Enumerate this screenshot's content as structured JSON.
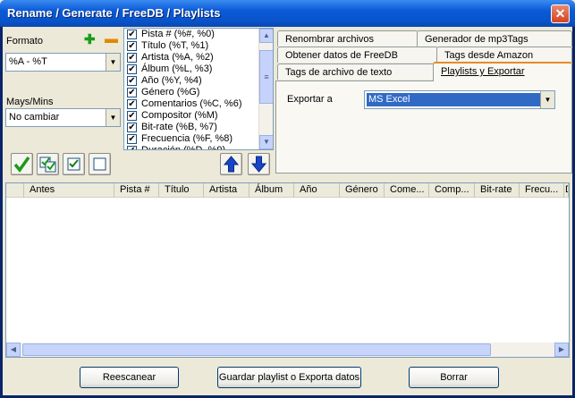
{
  "window": {
    "title": "Rename / Generate / FreeDB / Playlists",
    "close_label": "✕"
  },
  "formato": {
    "label": "Formato",
    "add_icon": "plus-icon",
    "remove_icon": "minus-icon",
    "value": "%A - %T"
  },
  "mays": {
    "label": "Mays/Mins",
    "value": "No cambiar"
  },
  "fields": [
    {
      "label": "Pista # (%#, %0)",
      "checked": true
    },
    {
      "label": "Título (%T, %1)",
      "checked": true
    },
    {
      "label": "Artista (%A, %2)",
      "checked": true
    },
    {
      "label": "Álbum (%L, %3)",
      "checked": true
    },
    {
      "label": "Año (%Y, %4)",
      "checked": true
    },
    {
      "label": "Género (%G)",
      "checked": true
    },
    {
      "label": "Comentarios (%C, %6)",
      "checked": true
    },
    {
      "label": "Compositor (%M)",
      "checked": true
    },
    {
      "label": "Bit-rate (%B, %7)",
      "checked": true
    },
    {
      "label": "Frecuencia (%F, %8)",
      "checked": true
    },
    {
      "label": "Duración (%D, %9)",
      "checked": true
    }
  ],
  "tabs": {
    "row1": [
      "Renombrar archivos",
      "Generador de mp3Tags"
    ],
    "row2": [
      "Obtener datos de FreeDB",
      "Tags desde Amazon"
    ],
    "row3": [
      "Tags de archivo de texto",
      "Playlists y Exportar"
    ]
  },
  "export": {
    "label": "Exportar a",
    "value": "MS Excel"
  },
  "grid": {
    "columns": [
      "Antes",
      "Pista #",
      "Título",
      "Artista",
      "Álbum",
      "Año",
      "Género",
      "Come...",
      "Comp...",
      "Bit-rate",
      "Frecu...",
      "D"
    ]
  },
  "buttons": {
    "rescan": "Reescanear",
    "save": "Guardar playlist o Exporta datos",
    "delete": "Borrar"
  }
}
